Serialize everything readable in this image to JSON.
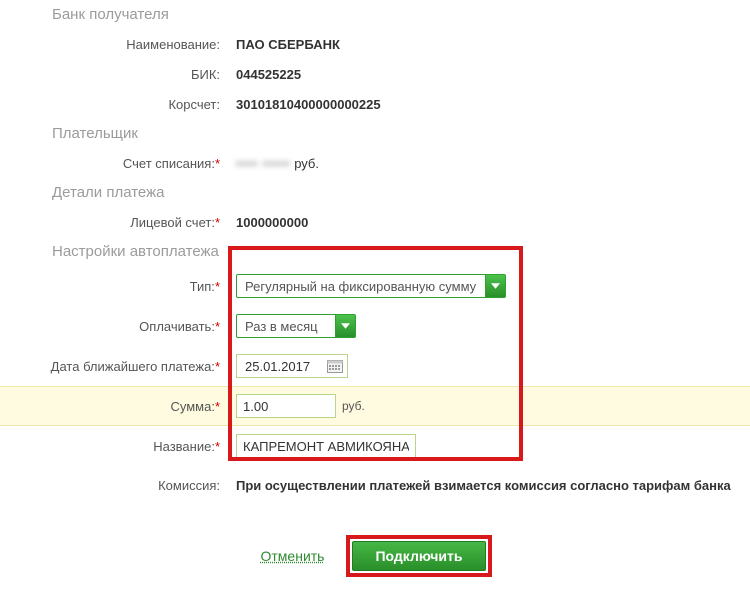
{
  "sections": {
    "bank_recipient": "Банк получателя",
    "payer": "Плательщик",
    "payment_details": "Детали платежа",
    "autopay_settings": "Настройки автоплатежа"
  },
  "labels": {
    "name": "Наименование:",
    "bik": "БИК:",
    "corr": "Корсчет:",
    "debit_account": "Счет списания:",
    "personal_account": "Лицевой счет:",
    "type": "Тип:",
    "pay_freq": "Оплачивать:",
    "next_date": "Дата ближайшего платежа:",
    "amount": "Сумма:",
    "title": "Название:",
    "commission": "Комиссия:"
  },
  "values": {
    "bank_name": "ПАО СБЕРБАНК",
    "bik": "044525225",
    "corr": "30101810400000000225",
    "currency": "руб.",
    "personal_account": "1000000000",
    "type_selected": "Регулярный на фиксированную сумму",
    "freq_selected": "Раз в месяц",
    "next_date": "25.01.2017",
    "amount": "1.00",
    "amount_unit": "руб.",
    "title": "КАПРЕМОНТ АВМИКОЯНА",
    "commission": "При осуществлении платежей взимается комиссия согласно тарифам банка"
  },
  "actions": {
    "cancel": "Отменить",
    "submit": "Подключить"
  }
}
